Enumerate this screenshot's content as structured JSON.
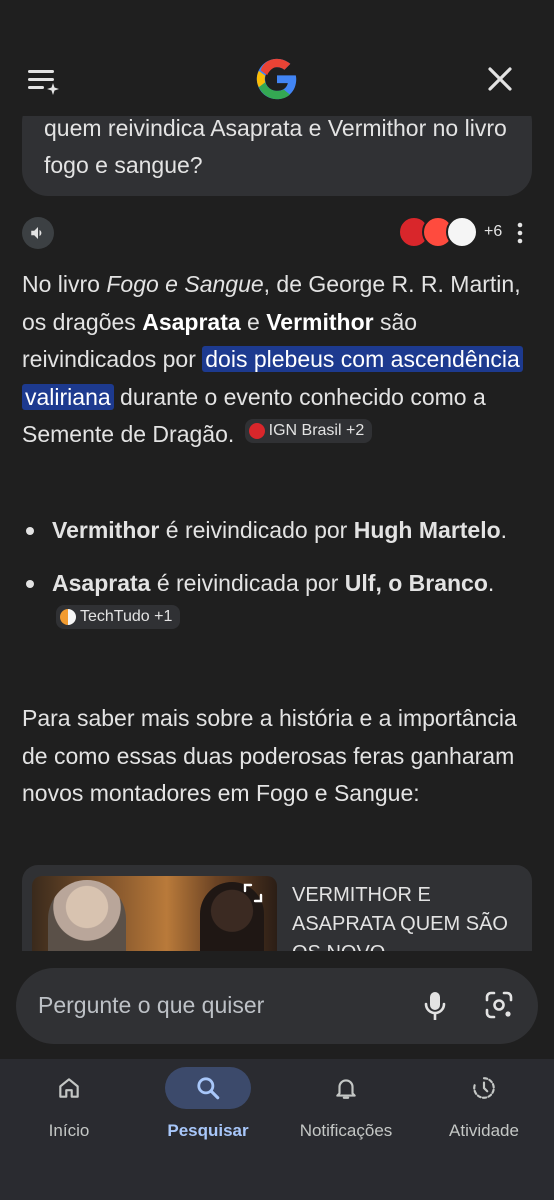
{
  "header": {
    "menu_icon": "menu-sparkle-icon",
    "logo": "google-g-logo",
    "close_icon": "close-icon"
  },
  "query": {
    "text": "quem reivindica Asaprata e Vermithor no livro fogo e sangue?"
  },
  "answer_toolbar": {
    "speaker_icon": "speaker-icon",
    "more_sources": "+6",
    "more_icon": "more-vert-icon"
  },
  "answer": {
    "p1_a": "No livro ",
    "p1_book": "Fogo e Sangue",
    "p1_b": ", de George R. R. Martin, os dragões ",
    "p1_dragon1": "Asaprata",
    "p1_c": " e ",
    "p1_dragon2": "Vermithor",
    "p1_d": " são reivindicados por ",
    "p1_highlight": "dois plebeus com ascendência valiriana",
    "p1_e": " durante o evento conhecido como a Semente de Dragão.",
    "chip1": "IGN Brasil +2",
    "bullets": [
      {
        "subject": "Vermithor",
        "verb": " é reivindicado por ",
        "claimer": "Hugh Martelo",
        "end": "."
      },
      {
        "subject": "Asaprata",
        "verb": " é reivindicada por ",
        "claimer": "Ulf, o Branco",
        "end": "."
      }
    ],
    "chip2": "TechTudo +1",
    "p2": "Para saber mais sobre a história e a importância de como essas duas poderosas feras ganharam novos montadores em Fogo e Sangue:"
  },
  "video": {
    "title": "VERMITHOR E ASAPRATA QUEM SÃO OS NOVO..."
  },
  "search": {
    "placeholder": "Pergunte o que quiser"
  },
  "nav": [
    {
      "label": "Início",
      "icon": "home-icon"
    },
    {
      "label": "Pesquisar",
      "icon": "search-icon"
    },
    {
      "label": "Notificações",
      "icon": "bell-icon"
    },
    {
      "label": "Atividade",
      "icon": "history-icon"
    }
  ],
  "colors": {
    "background": "#1f1f1f",
    "highlight": "#1d3a8f",
    "active_nav": "#a8c7fa"
  }
}
